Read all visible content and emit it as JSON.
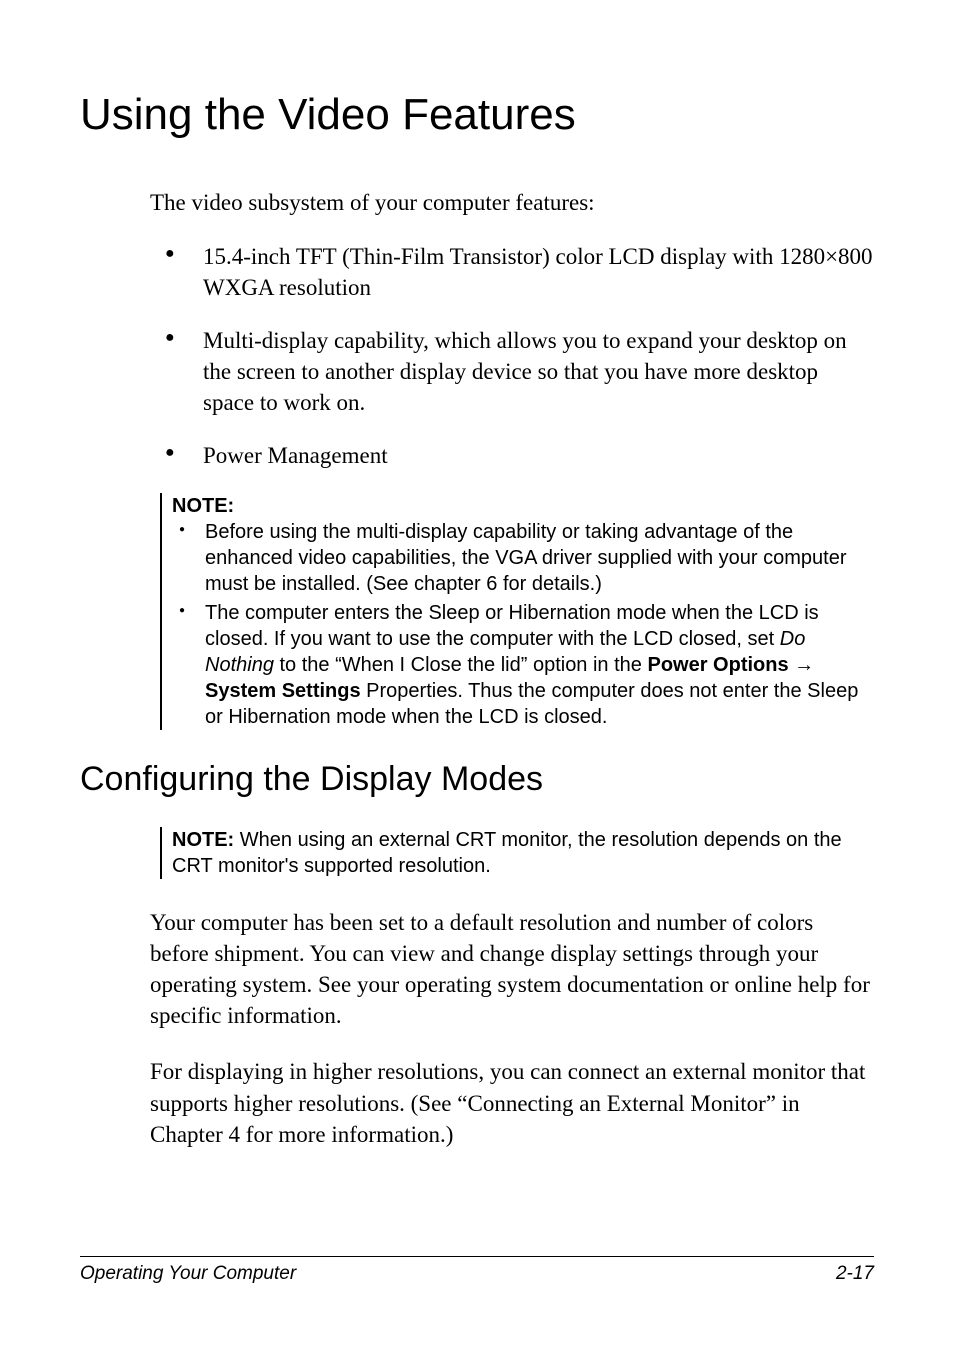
{
  "title": "Using the Video Features",
  "intro": "The video subsystem of your computer features:",
  "bullets": [
    "15.4-inch TFT (Thin-Film Transistor) color LCD display with 1280×800 WXGA resolution",
    "Multi-display capability, which allows you to expand your desktop on the screen to another display device so that you have more desktop space to work on.",
    "Power Management"
  ],
  "note1": {
    "label": "NOTE:",
    "items": {
      "a": "Before using the multi-display capability or taking advantage of the enhanced video capabilities, the VGA driver supplied with your computer must be installed. (See chapter 6 for details.)",
      "b_pre": "The computer enters the Sleep or Hibernation mode when the LCD is closed. If you want to use the computer with the LCD closed, set ",
      "b_italic": "Do Nothing",
      "b_mid1": " to the “When I Close the lid” option in the ",
      "b_bold1": "Power Options",
      "b_arrow": " → ",
      "b_bold2": "System Settings",
      "b_post": " Properties. Thus the computer does not enter the Sleep or Hibernation mode when the LCD is closed."
    }
  },
  "h2": "Configuring the Display Modes",
  "note2": {
    "label": "NOTE:",
    "text": " When using an external CRT monitor, the resolution depends on the CRT monitor's supported resolution."
  },
  "para1": "Your computer has been set to a default resolution and number of colors before shipment. You can view and change display settings through your operating system. See your operating system documentation or online help for specific information.",
  "para2": "For displaying in higher resolutions, you can connect an external monitor that supports higher resolutions. (See “Connecting an External Monitor” in Chapter 4 for more information.)",
  "footer": {
    "left": "Operating Your Computer",
    "right": "2-17"
  }
}
